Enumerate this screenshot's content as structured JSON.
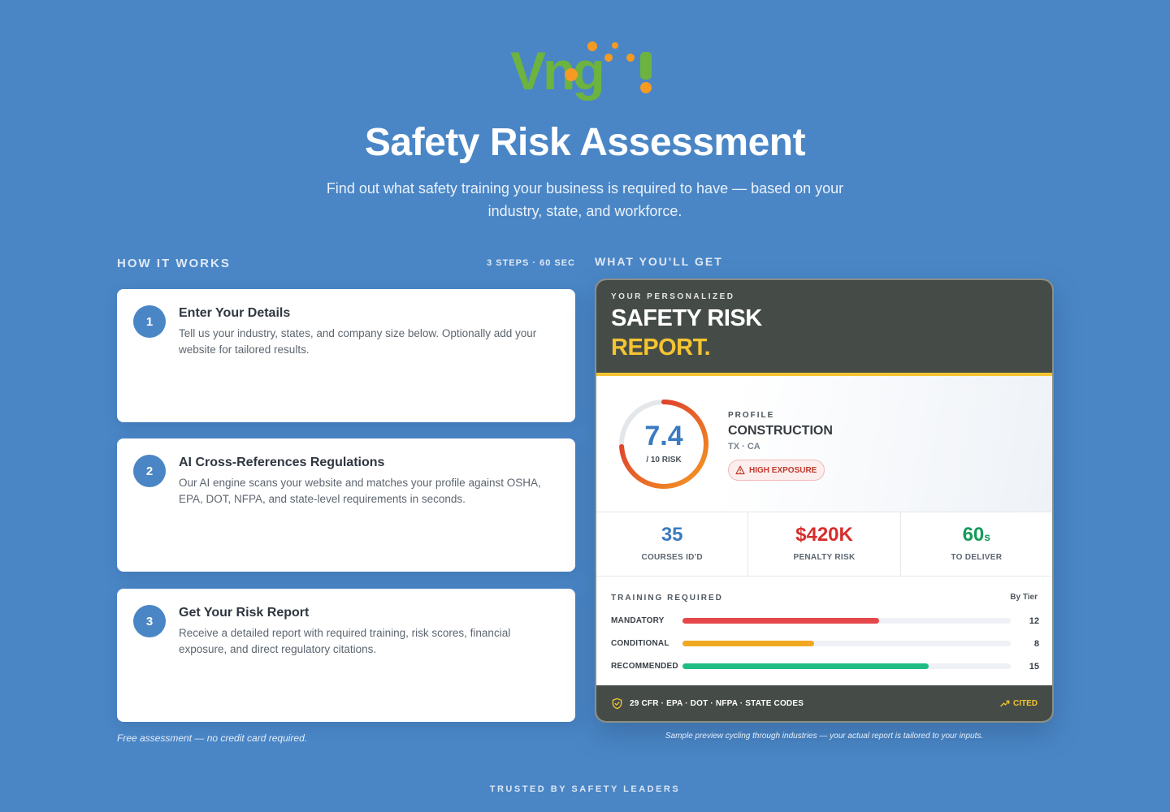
{
  "header": {
    "logo_text": "Ving!",
    "title": "Safety Risk Assessment",
    "subtitle": "Find out what safety training your business is required to have — based on your industry, state, and workforce."
  },
  "how_it_works": {
    "label": "HOW IT WORKS",
    "meta": "3 STEPS · 60 SEC",
    "steps": [
      {
        "number": "1",
        "title": "Enter Your Details",
        "description": "Tell us your industry, states, and company size below. Optionally add your website for tailored results."
      },
      {
        "number": "2",
        "title": "AI Cross-References Regulations",
        "description": "Our AI engine scans your website and matches your profile against OSHA, EPA, DOT, NFPA, and state-level requirements in seconds."
      },
      {
        "number": "3",
        "title": "Get Your Risk Report",
        "description": "Receive a detailed report with required training, risk scores, financial exposure, and direct regulatory citations."
      }
    ],
    "footnote": "Free assessment — no credit card required."
  },
  "what_you_get": {
    "label": "WHAT YOU'LL GET",
    "report": {
      "kicker": "YOUR PERSONALIZED",
      "title_line1": "SAFETY RISK",
      "title_line2": "REPORT.",
      "risk_score": "7.4",
      "risk_score_value": 7.4,
      "risk_score_max": 10,
      "risk_sub": "/ 10 RISK",
      "profile_label": "PROFILE",
      "industry": "CONSTRUCTION",
      "states": "TX · CA",
      "exposure_badge": "HIGH EXPOSURE",
      "stats": [
        {
          "value": "35",
          "unit": "",
          "label": "COURSES ID'D"
        },
        {
          "value": "$420K",
          "unit": "",
          "label": "PENALTY RISK"
        },
        {
          "value": "60",
          "unit": "s",
          "label": "TO DELIVER"
        }
      ],
      "training": {
        "label": "TRAINING REQUIRED",
        "tier_label": "By Tier",
        "rows": [
          {
            "name": "MANDATORY",
            "count": "12",
            "fill": 0.6,
            "color": "#e5474b"
          },
          {
            "name": "CONDITIONAL",
            "count": "8",
            "fill": 0.4,
            "color": "#f0a722"
          },
          {
            "name": "RECOMMENDED",
            "count": "15",
            "fill": 0.75,
            "color": "#1fbd84"
          }
        ]
      },
      "footer_text": "29 CFR · EPA · DOT · NFPA · STATE CODES",
      "cited_label": "CITED"
    },
    "footnote": "Sample preview cycling through industries — your actual report is tailored to your inputs."
  },
  "trusted_label": "TRUSTED BY SAFETY LEADERS",
  "colors": {
    "background": "#4a86c6",
    "accent_yellow": "#f4c431",
    "logo_green": "#6cb33f",
    "logo_orange": "#f59a23"
  },
  "icons": [
    "logo-mark",
    "warning-triangle-icon",
    "shield-check-icon",
    "trend-up-icon"
  ]
}
